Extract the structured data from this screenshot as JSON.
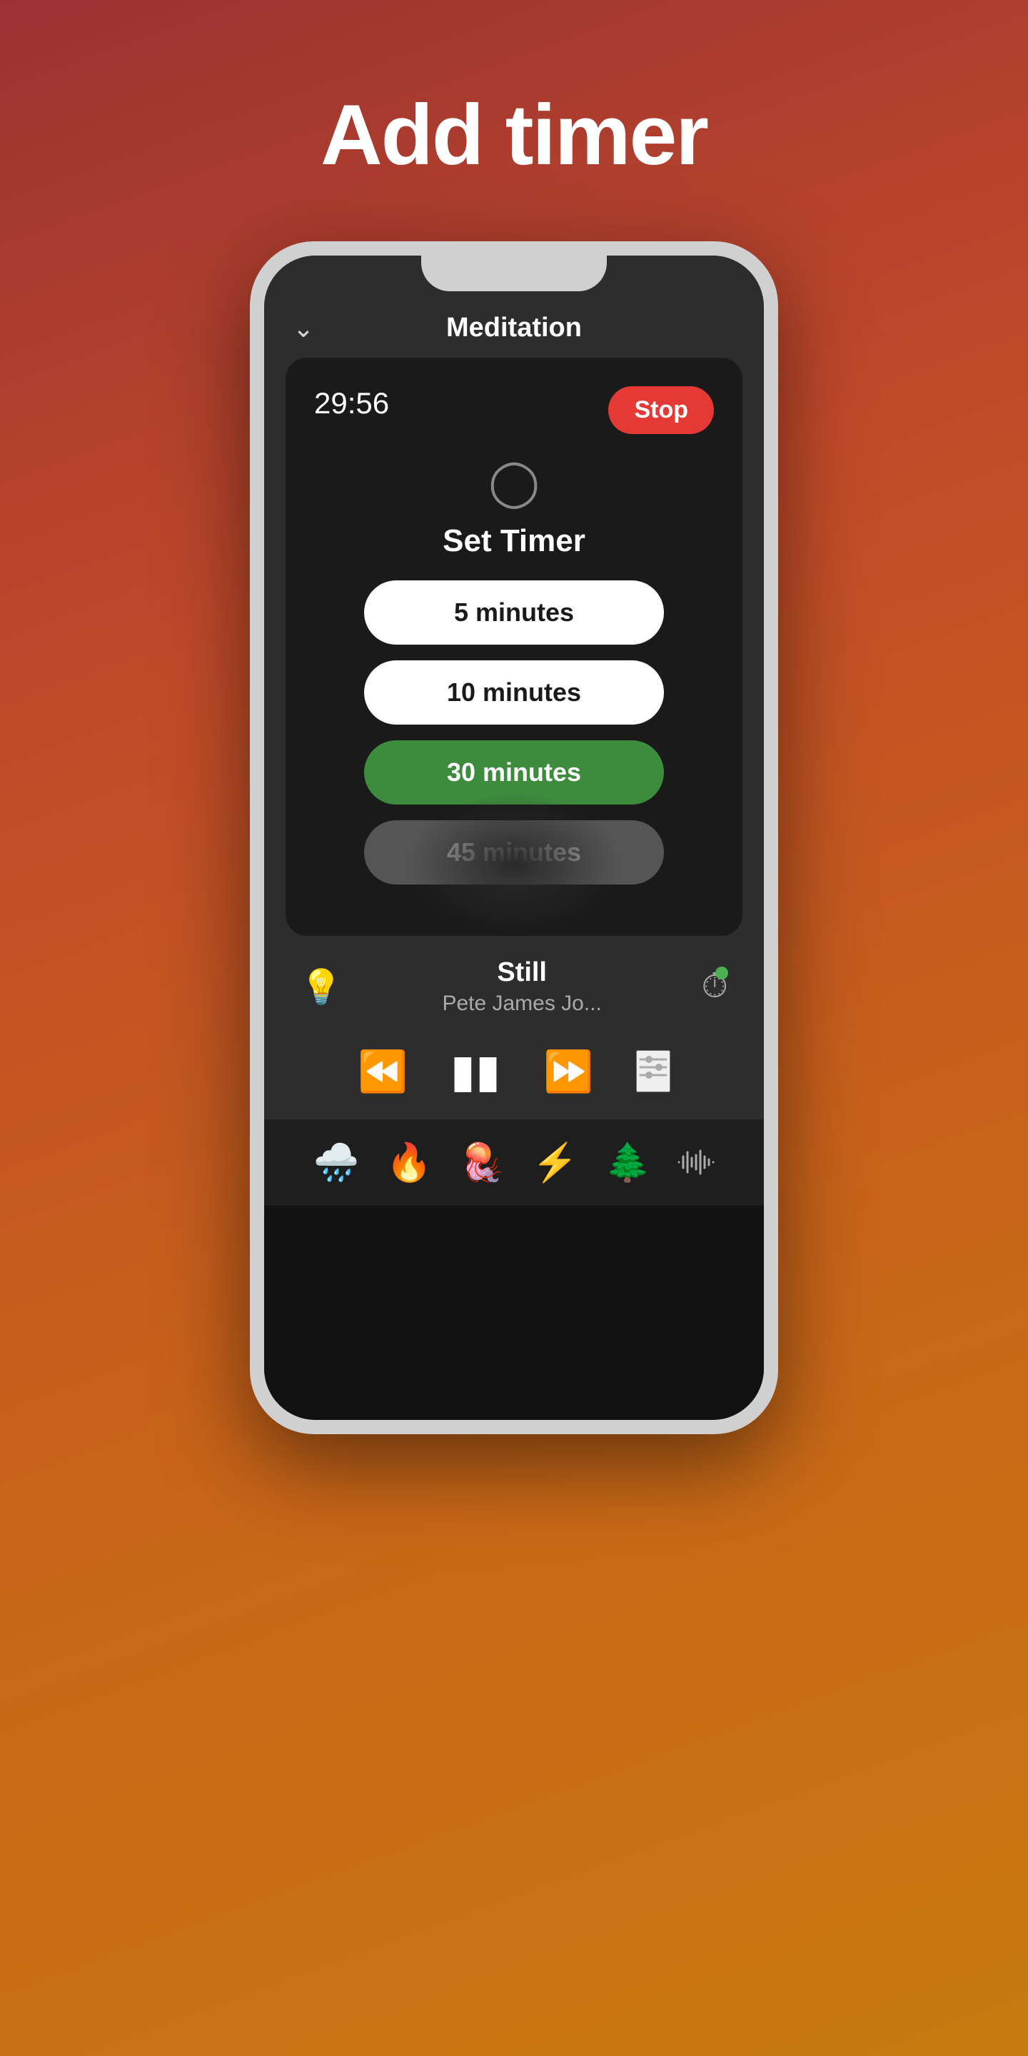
{
  "page": {
    "title": "Add timer",
    "background_gradient": "linear-gradient(160deg, #9b3232, #c04a2a, #c8621a, #c87a10)"
  },
  "nav": {
    "chevron_label": "chevron-down",
    "title": "Meditation"
  },
  "timer_card": {
    "time_display": "29:56",
    "stop_button_label": "Stop",
    "clock_icon_label": "clock-icon",
    "set_timer_title": "Set Timer",
    "options": [
      {
        "label": "5 minutes",
        "state": "normal"
      },
      {
        "label": "10 minutes",
        "state": "normal"
      },
      {
        "label": "30 minutes",
        "state": "selected"
      },
      {
        "label": "45 minutes",
        "state": "dimmed"
      }
    ]
  },
  "now_playing": {
    "bulb_icon": "lightbulb-icon",
    "track_title": "Still",
    "track_artist": "Pete James Jo...",
    "timer_icon": "stopwatch-icon",
    "timer_active": true
  },
  "controls": {
    "rewind_icon": "rewind-icon",
    "pause_icon": "pause-icon",
    "forward_icon": "forward-icon",
    "settings_icon": "settings-sliders-icon"
  },
  "sound_icons": [
    {
      "name": "rain-cloud-icon",
      "symbol": "🌧"
    },
    {
      "name": "fire-icon",
      "symbol": "🔥"
    },
    {
      "name": "jellyfish-icon",
      "symbol": "🪼"
    },
    {
      "name": "lightning-icon",
      "symbol": "⚡"
    },
    {
      "name": "tree-icon",
      "symbol": "🌲"
    },
    {
      "name": "waveform-icon",
      "symbol": "〰"
    }
  ]
}
